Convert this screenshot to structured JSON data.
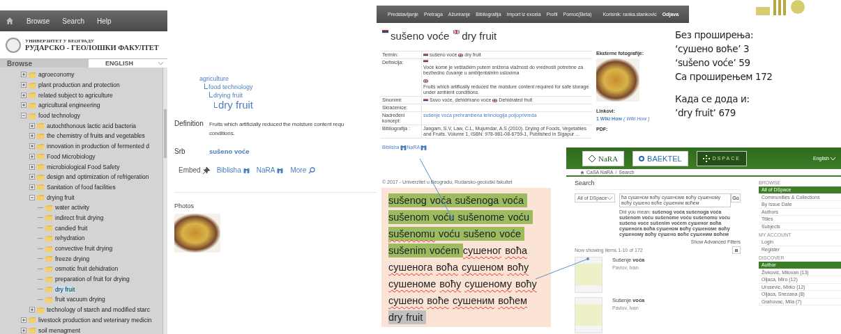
{
  "tree_app": {
    "menu": [
      "Browse",
      "Search",
      "Help"
    ],
    "logo": {
      "line1": "УНИВЕРЗИТЕТ У БЕОГРАДУ",
      "line2": "РУДАРСКО - ГЕОЛОШКИ ФАКУЛТЕТ"
    },
    "browse_label": "Browse",
    "language": "ENGLISH",
    "tree": [
      {
        "label": "agroeconomy",
        "expanded": false,
        "selected": false
      },
      {
        "label": "plant production and protection",
        "expanded": false,
        "selected": false
      },
      {
        "label": "related subject to agriculture",
        "expanded": false,
        "selected": false
      },
      {
        "label": "agricultural engineering",
        "expanded": false,
        "selected": false
      },
      {
        "label": "food technology",
        "expanded": true,
        "selected": false,
        "children": [
          {
            "label": "autochthonous lactic acid bacteria",
            "expanded": false,
            "selected": false
          },
          {
            "label": "the chemistry of fruits and vegetables",
            "expanded": false,
            "selected": false
          },
          {
            "label": "innovation in production of fermented d",
            "expanded": false,
            "selected": false
          },
          {
            "label": "Food Microbiology",
            "expanded": false,
            "selected": false
          },
          {
            "label": "microbiological Food Safety",
            "expanded": false,
            "selected": false
          },
          {
            "label": "design and optimization of refrigeration",
            "expanded": false,
            "selected": false
          },
          {
            "label": "Sanitation of food facilities",
            "expanded": false,
            "selected": false
          },
          {
            "label": "drying fruit",
            "expanded": true,
            "selected": false,
            "children": [
              {
                "label": "water activity",
                "selected": false
              },
              {
                "label": "indirect fruit drying",
                "selected": false
              },
              {
                "label": "candied fruit",
                "selected": false
              },
              {
                "label": "rehydration",
                "selected": false
              },
              {
                "label": "convective fruit drying",
                "selected": false
              },
              {
                "label": "freeze drying",
                "selected": false
              },
              {
                "label": "osmotic fruit dehidration",
                "selected": false
              },
              {
                "label": "preparation of fruit for drying",
                "selected": false
              },
              {
                "label": "dry fruit",
                "selected": true
              },
              {
                "label": "fruit vacuum drying",
                "selected": false
              }
            ]
          },
          {
            "label": "technology of starch and modified starc",
            "expanded": false,
            "selected": false
          }
        ]
      },
      {
        "label": "livestock production and veterinary medicin",
        "expanded": false,
        "selected": false
      },
      {
        "label": "soil menagment",
        "expanded": false,
        "selected": false
      }
    ]
  },
  "concept_page": {
    "breadcrumb": [
      "agriculture",
      "food technology",
      "drying fruit",
      "dry fruit"
    ],
    "definition_label": "Definition",
    "definition_lines": [
      "Fruits which artificially reduced the moisture content requ",
      "conditions."
    ],
    "srb_label": "Srb",
    "srb_value": "sušeno voće",
    "links": [
      {
        "label": "Embed",
        "kind": "pin"
      },
      {
        "label": "Biblisha",
        "kind": "binoculars"
      },
      {
        "label": "NaRA",
        "kind": "binoculars"
      },
      {
        "label": "More",
        "kind": "search"
      }
    ],
    "photos_label": "Photos"
  },
  "term_editor": {
    "menu": [
      "Predstavljanje",
      "Pretraga",
      "Ažuriranje",
      "Bibliografija",
      "Import iz excela",
      "Profil",
      "Pomoć(Beta)"
    ],
    "user": "Korisnik: ranka.stankovic",
    "logout": "Odjava",
    "title": [
      {
        "kind": "rs",
        "text": "sušeno voće"
      },
      {
        "kind": "gb",
        "text": "dry fruit"
      }
    ],
    "rows": [
      {
        "label": "Termin:",
        "kind": "text",
        "paragraphs": [
          [
            {
              "kind": "rs",
              "text": "sušeno voće"
            },
            {
              "kind": "gb",
              "text": "dry fruit"
            }
          ]
        ]
      },
      {
        "label": "Definicija:",
        "kind": "text",
        "paragraphs": [
          [
            {
              "kind": "rs",
              "text": "Voće kome je veštačkim putem snižena vlažnost do vrednosti potrebne za bezbedno čuvanje u ambijentalnim uslovima"
            }
          ],
          [
            {
              "kind": "gb",
              "text": "Fruits which artifically reduced the moisture content required for safe storage under ambient conditions."
            }
          ]
        ]
      },
      {
        "label": "Sinonimi:",
        "kind": "text",
        "paragraphs": [
          [
            {
              "kind": "rs",
              "text": "Suvo voće, dehidrirano voće"
            },
            {
              "kind": "gb",
              "text": "Dehidrated fruit"
            }
          ]
        ]
      },
      {
        "label": "Skraćenice:",
        "kind": "text",
        "paragraphs": []
      },
      {
        "label": "Nadređeni koncept:",
        "kind": "link",
        "paragraphs": [
          [
            {
              "text": "sušenje voća prehrambena tehnologija poljoprivreda"
            }
          ]
        ]
      },
      {
        "label": "Bibliografija :",
        "kind": "text",
        "paragraphs": [
          [
            {
              "text": "Jangam, S.V, Law, C.L, Mujumdar, A.S (2010). Drying of Foods, Vegetables and Fruits. Volume 1, ISBN: 978-981-08-6759-1, Published in Sigapur ..."
            }
          ]
        ]
      }
    ],
    "photos_label": "Eksterne fotografije:",
    "links_label": "Linkovi:",
    "wiki_link": "1 Wiki How",
    "wiki_note": "( Wiki How )",
    "pdf_label": "PDF:",
    "search_links": [
      "Biblisha",
      "NaRA"
    ],
    "footer": "© 2017 - Univerzitet u Beogradu, Rudarsko-geološki fakultet"
  },
  "notes": {
    "group1": [
      "Без проширења:",
      "‘сушено воће’ 3",
      "‘sušeno voće’ 59",
      "Са проширењем 172"
    ],
    "group2": [
      "Када се дода и:",
      "’dry fruit’ 679"
    ]
  },
  "annotation": {
    "words": [
      {
        "text": "sušenog",
        "color": "#9dbb61",
        "misspelled": false
      },
      {
        "text": "voća",
        "color": "#9dbb61",
        "misspelled": false
      },
      {
        "text": "sušenoga",
        "color": "#9dbb61",
        "misspelled": false
      },
      {
        "text": "voća",
        "color": "#9dbb61",
        "misspelled": false
      },
      {
        "text": "sušenom",
        "color": "#9dbb61",
        "misspelled": false
      },
      {
        "text": "voću",
        "color": "#9dbb61",
        "misspelled": false
      },
      {
        "text": "sušenome",
        "color": "#9dbb61",
        "misspelled": false
      },
      {
        "text": "voću",
        "color": "#9dbb61",
        "misspelled": false
      },
      {
        "text": "sušenomu",
        "color": "#9dbb61",
        "misspelled": true
      },
      {
        "text": "voću",
        "color": "#9dbb61",
        "misspelled": false
      },
      {
        "text": "sušeno",
        "color": "#9dbb61",
        "misspelled": false
      },
      {
        "text": "voće",
        "color": "#9dbb61",
        "misspelled": false
      },
      {
        "text": "sušenim",
        "color": "#9dbb61",
        "misspelled": false
      },
      {
        "text": "voćem",
        "color": "#9dbb61",
        "misspelled": false
      },
      {
        "text": "сушеног",
        "misspelled": true
      },
      {
        "text": "воћа",
        "misspelled": true
      },
      {
        "text": "сушенога",
        "misspelled": true
      },
      {
        "text": "воћа",
        "misspelled": true
      },
      {
        "text": "сушеном",
        "misspelled": true
      },
      {
        "text": "воћу",
        "misspelled": true
      },
      {
        "text": "сушеноме",
        "misspelled": true
      },
      {
        "text": "воћу",
        "misspelled": true
      },
      {
        "text": "сушеному",
        "misspelled": true
      },
      {
        "text": "воћу",
        "misspelled": true
      },
      {
        "text": "сушено",
        "misspelled": true
      },
      {
        "text": "воће",
        "misspelled": true
      },
      {
        "text": "сушеним",
        "misspelled": true
      },
      {
        "text": "воћем",
        "misspelled": true
      },
      {
        "text": "dry",
        "color": "#c0c0c0",
        "misspelled": false
      },
      {
        "text": "fruit",
        "color": "#c0c0c0",
        "misspelled": false
      }
    ]
  },
  "dspace": {
    "logos": [
      "NaRA",
      "BAEKTEL",
      "DSPACE"
    ],
    "language": "English",
    "breadcrumb": [
      "CaSA NaRA",
      "Search"
    ],
    "breadcrumb_separator": "/",
    "heading": "Search",
    "scope": "All of DSpace",
    "query": "ћа сушеном воћу сушеноме воћу сушеному воћу сушено воће сушеним воћем",
    "go": "Go",
    "did_you_mean_label": "Did you mean:",
    "did_you_mean": "sušenog voća sušenoga voća sušenom voću sušenome voću sušenomu voću sušeno voće sušenim voćem сушеног воћа сушенога воћа сушеном воћу сушеноме воћу сушеному воћу сушено воће сушеним воћем",
    "advanced": "Show Advanced Filters",
    "count": "Now showing items 1-10 of 172",
    "results": [
      {
        "title": "Sušenje **voća**",
        "author": "Pavlov, Ivan"
      },
      {
        "title": "Sušenje **voća**",
        "author": "Pavlov, Ivan"
      }
    ],
    "sidebar": [
      {
        "heading": "BROWSE",
        "items": [
          {
            "label": "All of DSpace",
            "selected": true
          },
          {
            "label": "Communities & Collections",
            "selected": false
          },
          {
            "label": "By Issue Date",
            "selected": false
          },
          {
            "label": "Authors",
            "selected": false
          },
          {
            "label": "Titles",
            "selected": false
          },
          {
            "label": "Subjects",
            "selected": false
          }
        ]
      },
      {
        "heading": "MY ACCOUNT",
        "items": [
          {
            "label": "Login",
            "selected": false
          },
          {
            "label": "Register",
            "selected": false
          }
        ]
      },
      {
        "heading": "DISCOVER",
        "items": [
          {
            "label": "Author",
            "selected": true
          },
          {
            "label": "Živković, Milovan (13)",
            "selected": false
          },
          {
            "label": "Oljaca, Miro (12)",
            "selected": false
          },
          {
            "label": "Urosevic, Mirko (12)",
            "selected": false
          },
          {
            "label": "Oljaca, Snezana (8)",
            "selected": false
          },
          {
            "label": "Grahovac, Mila (7)",
            "selected": false
          }
        ]
      }
    ]
  }
}
